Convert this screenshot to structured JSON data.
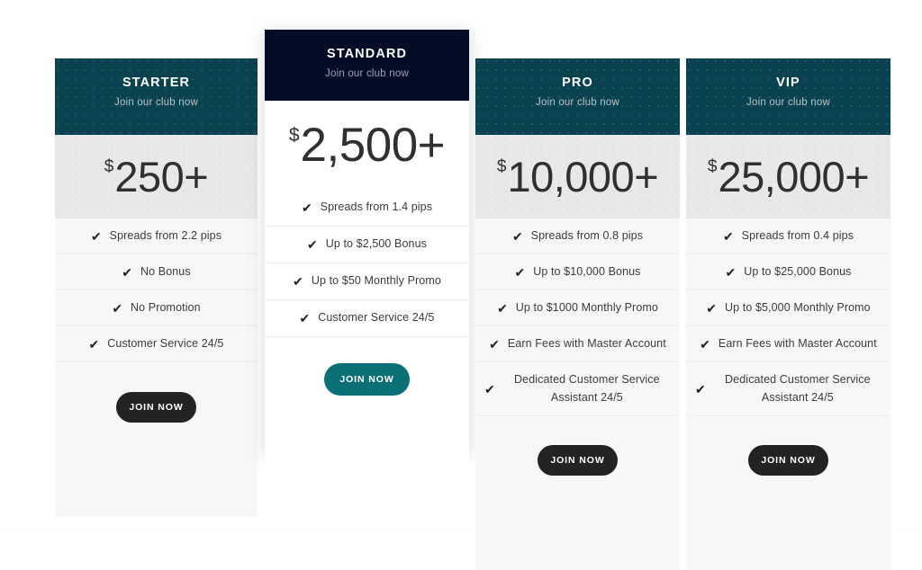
{
  "page": {
    "background": "#ffffff",
    "accent_teal": "#0b7076",
    "header_teal": "#0b4250",
    "header_navy": "#030e26",
    "button_dark": "#232323"
  },
  "check_glyph": "✔",
  "plans": [
    {
      "id": "starter",
      "name": "STARTER",
      "subtitle": "Join our club now",
      "currency": "$",
      "amount": "250+",
      "featured": false,
      "features": [
        "Spreads from 2.2 pips",
        "No Bonus",
        "No Promotion",
        "Customer Service 24/5"
      ],
      "cta_label": "JOIN NOW"
    },
    {
      "id": "standard",
      "name": "STANDARD",
      "subtitle": "Join our club now",
      "currency": "$",
      "amount": "2,500+",
      "featured": true,
      "features": [
        "Spreads from 1.4 pips",
        "Up to $2,500 Bonus",
        "Up to $50 Monthly Promo",
        "Customer Service 24/5"
      ],
      "cta_label": "JOIN NOW"
    },
    {
      "id": "pro",
      "name": "PRO",
      "subtitle": "Join our club now",
      "currency": "$",
      "amount": "10,000+",
      "featured": false,
      "features": [
        "Spreads from 0.8 pips",
        "Up to $10,000 Bonus",
        "Up to $1000 Monthly Promo",
        "Earn Fees with Master Account",
        "Dedicated Customer Service Assistant 24/5"
      ],
      "cta_label": "JOIN NOW"
    },
    {
      "id": "vip",
      "name": "VIP",
      "subtitle": "Join our club now",
      "currency": "$",
      "amount": "25,000+",
      "featured": false,
      "features": [
        "Spreads from 0.4 pips",
        "Up to $25,000 Bonus",
        "Up to $5,000 Monthly Promo",
        "Earn Fees with Master Account",
        "Dedicated Customer Service Assistant 24/5"
      ],
      "cta_label": "JOIN NOW"
    }
  ]
}
